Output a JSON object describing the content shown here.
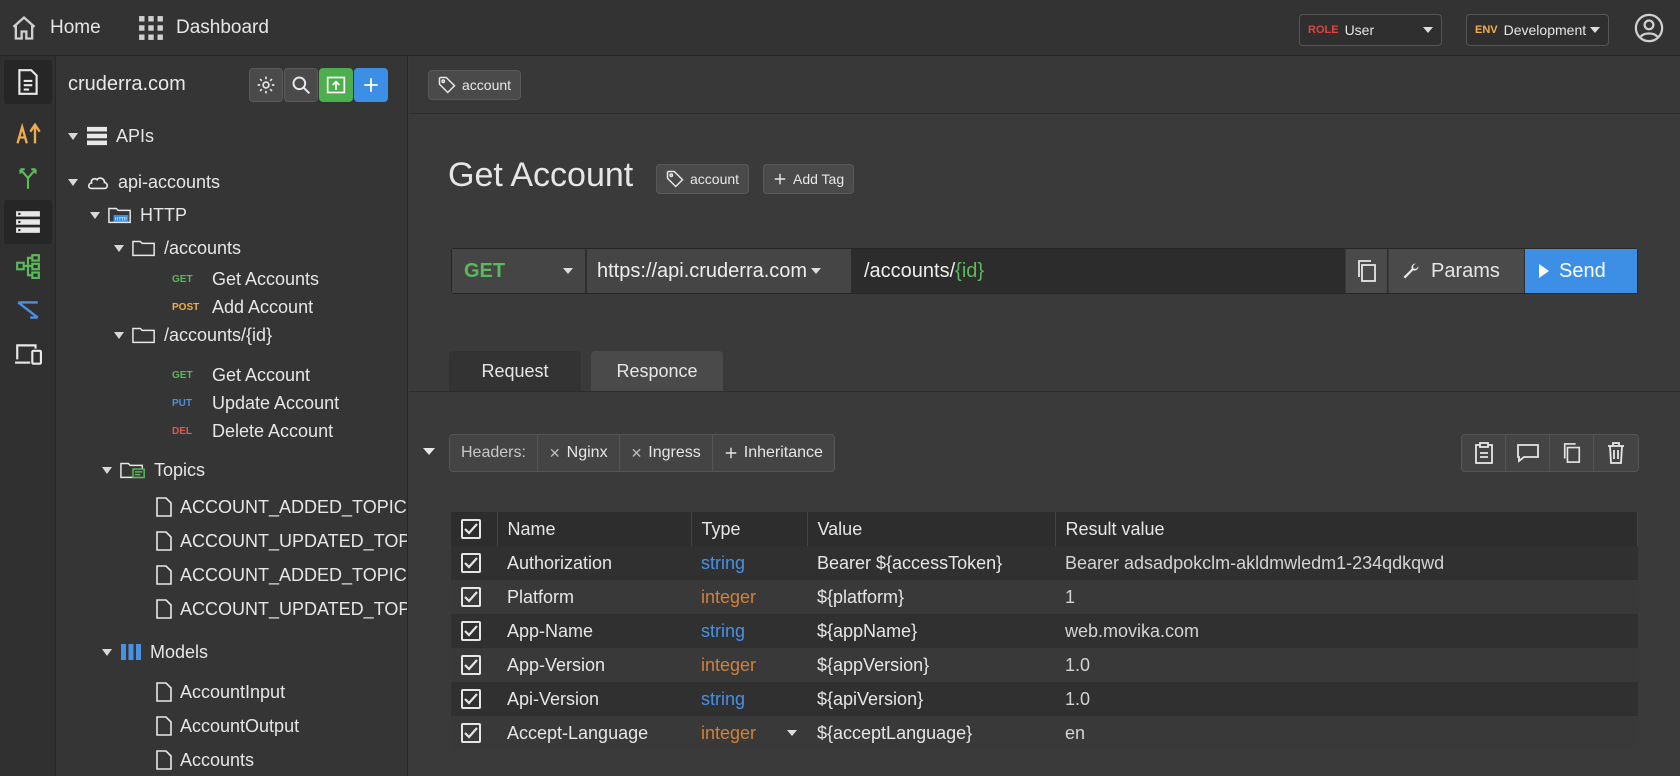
{
  "topbar": {
    "home_label": "Home",
    "dashboard_label": "Dashboard",
    "role": {
      "prefix": "ROLE",
      "value": "User",
      "prefix_color": "#e0443e"
    },
    "env": {
      "prefix": "ENV",
      "value": "Development",
      "prefix_color": "#f0ad4e"
    }
  },
  "sidebar": {
    "title": "cruderra.com",
    "tree": {
      "apis": "APIs",
      "service": "api-accounts",
      "http": "HTTP",
      "folder1": "/accounts",
      "get_accounts_method": "GET",
      "get_accounts": "Get Accounts",
      "add_account_method": "POST",
      "add_account": "Add Account",
      "folder2": "/accounts/{id}",
      "get_account_method": "GET",
      "get_account": "Get Account",
      "update_account_method": "PUT",
      "update_account": "Update Account",
      "delete_account_method": "DEL",
      "delete_account": "Delete Account",
      "topics": "Topics",
      "topic_items": [
        "ACCOUNT_ADDED_TOPIC",
        "ACCOUNT_UPDATED_TOPIC",
        "ACCOUNT_ADDED_TOPIC",
        "ACCOUNT_UPDATED_TOPIC"
      ],
      "models": "Models",
      "model_items": [
        "AccountInput",
        "AccountOutput",
        "Accounts"
      ]
    }
  },
  "main": {
    "breadcrumb_tag": "account",
    "title": "Get Account",
    "tag": "account",
    "add_tag": "Add Tag",
    "request": {
      "method": "GET",
      "base_url": "https://api.cruderra.com",
      "path_prefix": "/accounts/",
      "path_param": "{id}",
      "params_label": "Params",
      "send_label": "Send"
    },
    "tabs": [
      "Request",
      "Responce"
    ],
    "headers": {
      "label": "Headers:",
      "chips": [
        "Nginx",
        "Ingress"
      ],
      "inheritance": "Inheritance"
    },
    "table": {
      "columns": [
        "Name",
        "Type",
        "Value",
        "Result value"
      ],
      "rows": [
        {
          "name": "Authorization",
          "type": "string",
          "value": "Bearer ${accessToken}",
          "result": "Bearer adsadpokclm-akldmwledm1-234qdkqwd"
        },
        {
          "name": "Platform",
          "type": "integer",
          "value": "${platform}",
          "result": "1"
        },
        {
          "name": "App-Name",
          "type": "string",
          "value": "${appName}",
          "result": "web.movika.com"
        },
        {
          "name": "App-Version",
          "type": "integer",
          "value": "${appVersion}",
          "result": "1.0"
        },
        {
          "name": "Api-Version",
          "type": "string",
          "value": "${apiVersion}",
          "result": "1.0"
        },
        {
          "name": "Accept-Language",
          "type": "integer",
          "value": "${acceptLanguage}",
          "result": "en"
        }
      ]
    }
  },
  "colors": {
    "accent": "#3d8fe6",
    "get": "#5cb85c",
    "post": "#f0ad4e",
    "put": "#4a90e2",
    "del": "#e05a4f",
    "string": "#4a90e2",
    "integer": "#d0813b"
  }
}
